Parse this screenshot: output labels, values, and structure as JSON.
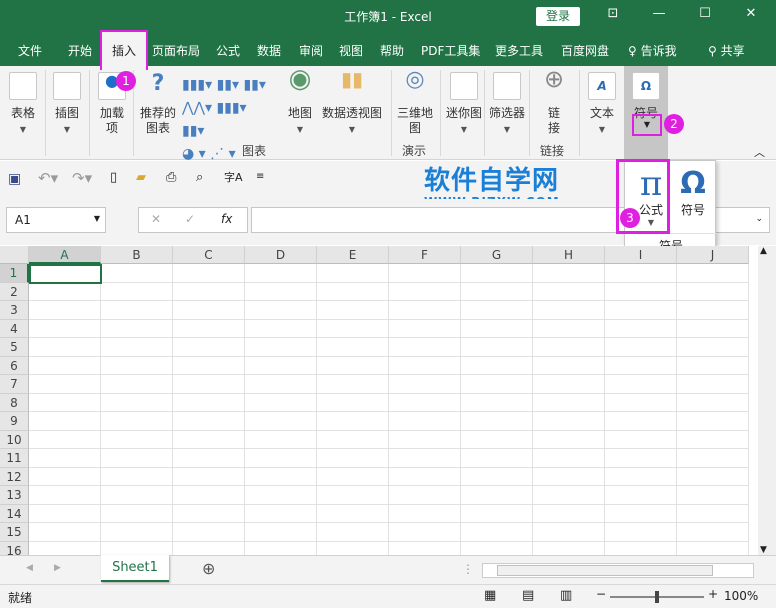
{
  "titlebar": {
    "title": "工作簿1  -  Excel",
    "login": "登录"
  },
  "tabs": [
    "文件",
    "开始",
    "插入",
    "页面布局",
    "公式",
    "数据",
    "审阅",
    "视图",
    "帮助",
    "PDF工具集",
    "更多工具",
    "百度网盘",
    "告诉我",
    "共享"
  ],
  "ribbon": {
    "buttons": {
      "table": "表格",
      "illustrations": "插图",
      "addins": "加载项",
      "recommended_charts": "推荐的图表",
      "maps": "地图",
      "pivot_chart": "数据透视图",
      "3d_map": "三维地图",
      "sparklines": "迷你图",
      "filters": "筛选器",
      "link": "链接",
      "text": "文本",
      "symbols": "符号"
    },
    "groups": {
      "charts": "图表",
      "tours": "演示",
      "links": "链接"
    }
  },
  "popup": {
    "equation": "公式",
    "symbol": "符号",
    "group": "符号",
    "pi": "π",
    "omega": "Ω"
  },
  "badges": [
    "1",
    "2",
    "3"
  ],
  "watermark": {
    "cn": "软件自学网",
    "url": "WWW.RJZXW.COM"
  },
  "namebox": "A1",
  "fx": "fx",
  "columns": [
    "A",
    "B",
    "C",
    "D",
    "E",
    "F",
    "G",
    "H",
    "I",
    "J"
  ],
  "rows": [
    "1",
    "2",
    "3",
    "4",
    "5",
    "6",
    "7",
    "8",
    "9",
    "10",
    "11",
    "12",
    "13",
    "14",
    "15",
    "16"
  ],
  "sheet": {
    "name": "Sheet1"
  },
  "status": {
    "ready": "就绪",
    "zoom": "100%"
  },
  "colors": {
    "green": "#217346",
    "highlight": "#e020e0",
    "watermark": "#1a7fd6"
  }
}
